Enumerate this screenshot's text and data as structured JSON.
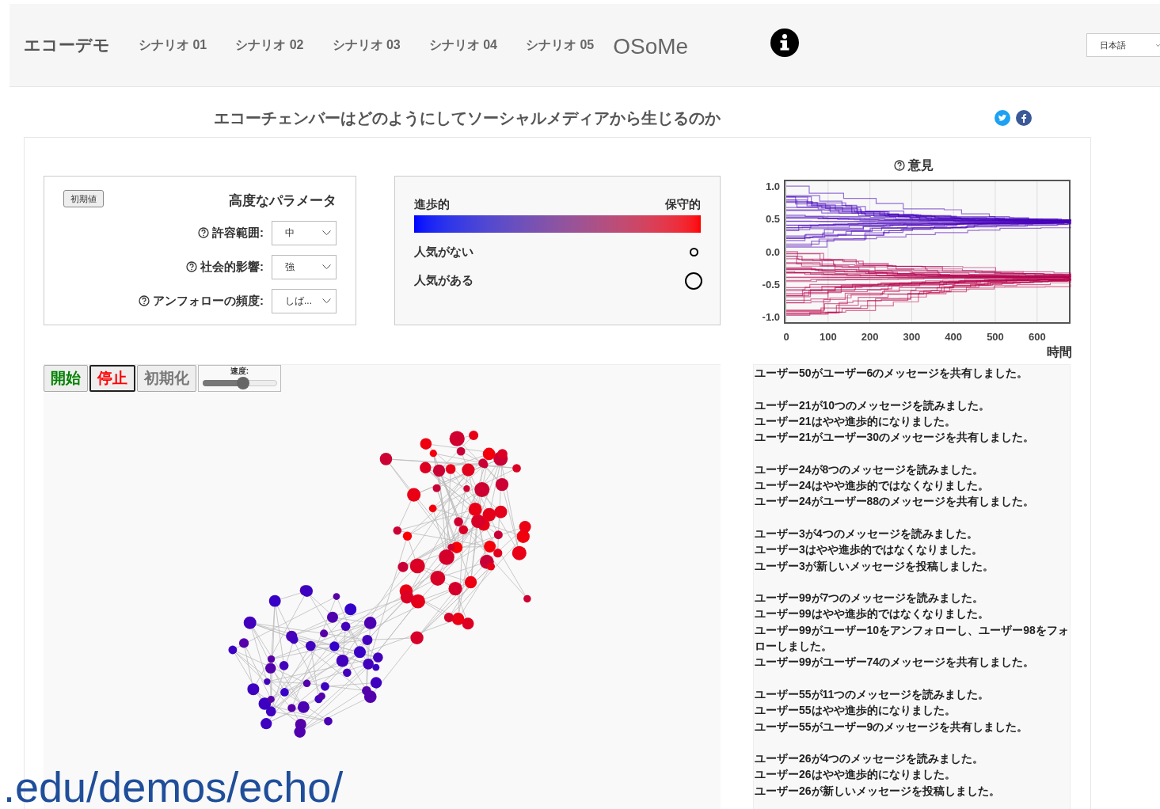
{
  "nav": {
    "brand": "エコーデモ",
    "items": [
      {
        "label": "シナリオ 01"
      },
      {
        "label": "シナリオ 02"
      },
      {
        "label": "シナリオ 03"
      },
      {
        "label": "シナリオ 04"
      },
      {
        "label": "シナリオ 05"
      }
    ],
    "logo": "OSoMe",
    "language": "日本語"
  },
  "page_title": "エコーチェンバーはどのようにしてソーシャルメディアから生じるのか",
  "params": {
    "reset_button": "初期値",
    "title": "高度なパラメータ",
    "fields": [
      {
        "label": "許容範囲:",
        "value": "中"
      },
      {
        "label": "社会的影響:",
        "value": "強"
      },
      {
        "label": "アンフォローの頻度:",
        "value": "しば..."
      }
    ]
  },
  "legend": {
    "left": "進歩的",
    "right": "保守的",
    "sizes": [
      {
        "label": "人気がない",
        "kind": "small"
      },
      {
        "label": "人気がある",
        "kind": "large"
      }
    ]
  },
  "controls": {
    "buttons": [
      {
        "label": "開始",
        "color": "#008000",
        "selected": false
      },
      {
        "label": "停止",
        "color": "#ff0000",
        "selected": true
      },
      {
        "label": "初期化",
        "color": "#777777",
        "selected": false
      }
    ],
    "speed": {
      "label": "速度:",
      "level": 0.55
    }
  },
  "opinion_plot": {
    "title": "意見",
    "yticks": [
      "1.0",
      "0.5",
      "0.0",
      "-0.5",
      "-1.0"
    ],
    "xticks": [
      "0",
      "100",
      "200",
      "300",
      "400",
      "500",
      "600"
    ],
    "xlabel": "時間"
  },
  "log": [
    [
      "ユーザー50がユーザー6のメッセージを共有しました。"
    ],
    [
      "ユーザー21が10つのメッセージを読みました。",
      "ユーザー21はやや進歩的になりました。",
      "ユーザー21がユーザー30のメッセージを共有しました。"
    ],
    [
      "ユーザー24が8つのメッセージを読みました。",
      "ユーザー24はやや進歩的ではなくなりました。",
      "ユーザー24がユーザー88のメッセージを共有しました。"
    ],
    [
      "ユーザー3が4つのメッセージを読みました。",
      "ユーザー3はやや進歩的ではなくなりました。",
      "ユーザー3が新しいメッセージを投稿しました。"
    ],
    [
      "ユーザー99が7つのメッセージを読みました。",
      "ユーザー99はやや進歩的ではなくなりました。",
      "ユーザー99がユーザー10をアンフォローし、ユーザー98をフォローしました。",
      "ユーザー99がユーザー74のメッセージを共有しました。"
    ],
    [
      "ユーザー55が11つのメッセージを読みました。",
      "ユーザー55はやや進歩的になりました。",
      "ユーザー55がユーザー9のメッセージを共有しました。"
    ],
    [
      "ユーザー26が4つのメッセージを読みました。",
      "ユーザー26はやや進歩的になりました。",
      "ユーザー26が新しいメッセージを投稿しました。"
    ]
  ],
  "url_overlay": ".edu/demos/echo/"
}
